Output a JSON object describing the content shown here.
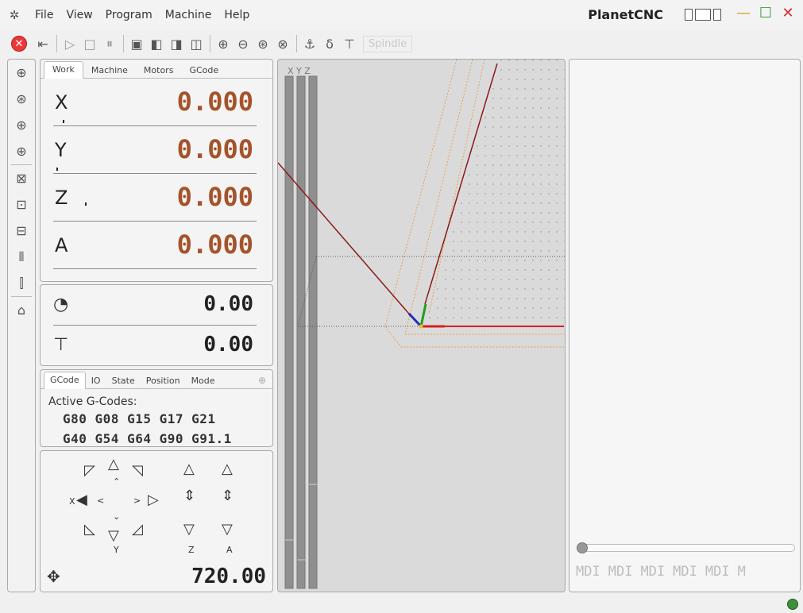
{
  "menu": {
    "logo_icon": "cnc-logo-icon",
    "items": [
      "File",
      "View",
      "Program",
      "Machine",
      "Help"
    ]
  },
  "app_title": "PlanetCNC",
  "toolbar": {
    "buttons": [
      "stop",
      "exit",
      "play",
      "stop-square",
      "pause",
      "view-front",
      "view-side",
      "view-top",
      "view-iso",
      "zoom-in",
      "zoom-out",
      "zoom-fit",
      "zoom-all",
      "tool-probe",
      "tool-measure",
      "spindle-icon"
    ],
    "spindle_label": "Spindle"
  },
  "coord_tabs": [
    "Work",
    "Machine",
    "Motors",
    "GCode"
  ],
  "axes": [
    {
      "label": "X",
      "value": "0.000"
    },
    {
      "label": "Y",
      "value": "0.000"
    },
    {
      "label": "Z",
      "value": "0.000"
    },
    {
      "label": "A",
      "value": "0.000"
    }
  ],
  "feed": {
    "value": "0.00"
  },
  "spindle": {
    "value": "0.00"
  },
  "info_tabs": [
    "GCode",
    "IO",
    "State",
    "Position",
    "Mode"
  ],
  "gcode": {
    "title": "Active G-Codes:",
    "line1": "G80 G08 G15 G17 G21",
    "line2": "G40 G54 G64 G90 G91.1"
  },
  "jog": {
    "labels": {
      "y": "Y",
      "z": "Z",
      "a": "A",
      "x": "X"
    },
    "value": "720.00"
  },
  "view": {
    "axis_bar_labels": "X Y Z"
  },
  "mdi": [
    "MDI",
    "MDI",
    "MDI",
    "MDI",
    "MDI",
    "M"
  ],
  "colors": {
    "accent_value": "#a5532a",
    "stop_red": "#e83a3a",
    "status_green": "#3c8f3c"
  }
}
